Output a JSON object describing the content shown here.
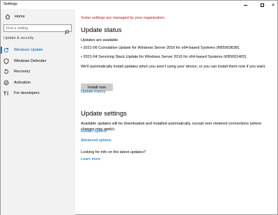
{
  "window": {
    "title": "Settings",
    "controls": {
      "minimize": "minimize-icon",
      "maximize": "maximize-icon",
      "close_glyph": "✕"
    }
  },
  "sidebar": {
    "home_label": "Home",
    "search_placeholder": "Find a setting",
    "section_label": "Update & security",
    "items": [
      {
        "label": "Windows Update",
        "icon": "sync-icon",
        "active": true
      },
      {
        "label": "Windows Defender",
        "icon": "shield-icon",
        "active": false
      },
      {
        "label": "Recovery",
        "icon": "recovery-icon",
        "active": false
      },
      {
        "label": "Activation",
        "icon": "activation-icon",
        "active": false
      },
      {
        "label": "For developers",
        "icon": "developer-icon",
        "active": false
      }
    ]
  },
  "main": {
    "org_note": "Some settings are managed by your organization.",
    "status": {
      "heading": "Update status",
      "available": "Updates are available.",
      "updates": [
        "• 2021-06 Cumulative Update for Windows Server 2016 for x64-based Systems (KB5003638).",
        "• 2021-04 Servicing Stack Update for Windows Server 2016 for x64-based Systems (KB5001402)."
      ],
      "auto_note": "We'll automatically install updates when you aren't using your device, or you can install them now if you want.",
      "install_button": "Install now",
      "history_link": "Update history"
    },
    "settings": {
      "heading": "Update settings",
      "description": "Available updates will be downloaded and installed automatically, except over metered connections (where charges may apply).",
      "restart_link": "Restart options",
      "advanced_link": "Advanced options",
      "info_question": "Looking for info on the latest updates?",
      "learn_more_link": "Learn more"
    }
  },
  "colors": {
    "accent": "#0078d7",
    "link": "#0063b1",
    "warning": "#b5121b",
    "sidebar_bg": "#f2f2f2",
    "button_bg": "#cccccc"
  }
}
